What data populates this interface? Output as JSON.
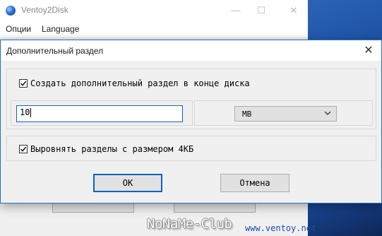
{
  "main_window": {
    "title": "Ventoy2Disk",
    "controls": [
      "—",
      "☐",
      "✕"
    ],
    "menu": [
      "Опции",
      "Language"
    ],
    "footer_link": "www.ventoy.net",
    "watermark": "NoNaMe-Club"
  },
  "dialog": {
    "title": "Дополнительный раздел",
    "close_glyph": "✕",
    "create_partition": {
      "label": "Создать дополнительный раздел в конце диска",
      "checked": true
    },
    "size_input": {
      "value": "10"
    },
    "unit_select": {
      "value": "MB"
    },
    "align_partitions": {
      "label": "Выровнять разделы с размером 4КБ",
      "checked": true
    },
    "ok_label": "OK",
    "cancel_label": "Отмена"
  },
  "colors": {
    "accent": "#0a64c9",
    "dialog_bg": "#f0f0f0",
    "link": "#1a4aa6"
  }
}
